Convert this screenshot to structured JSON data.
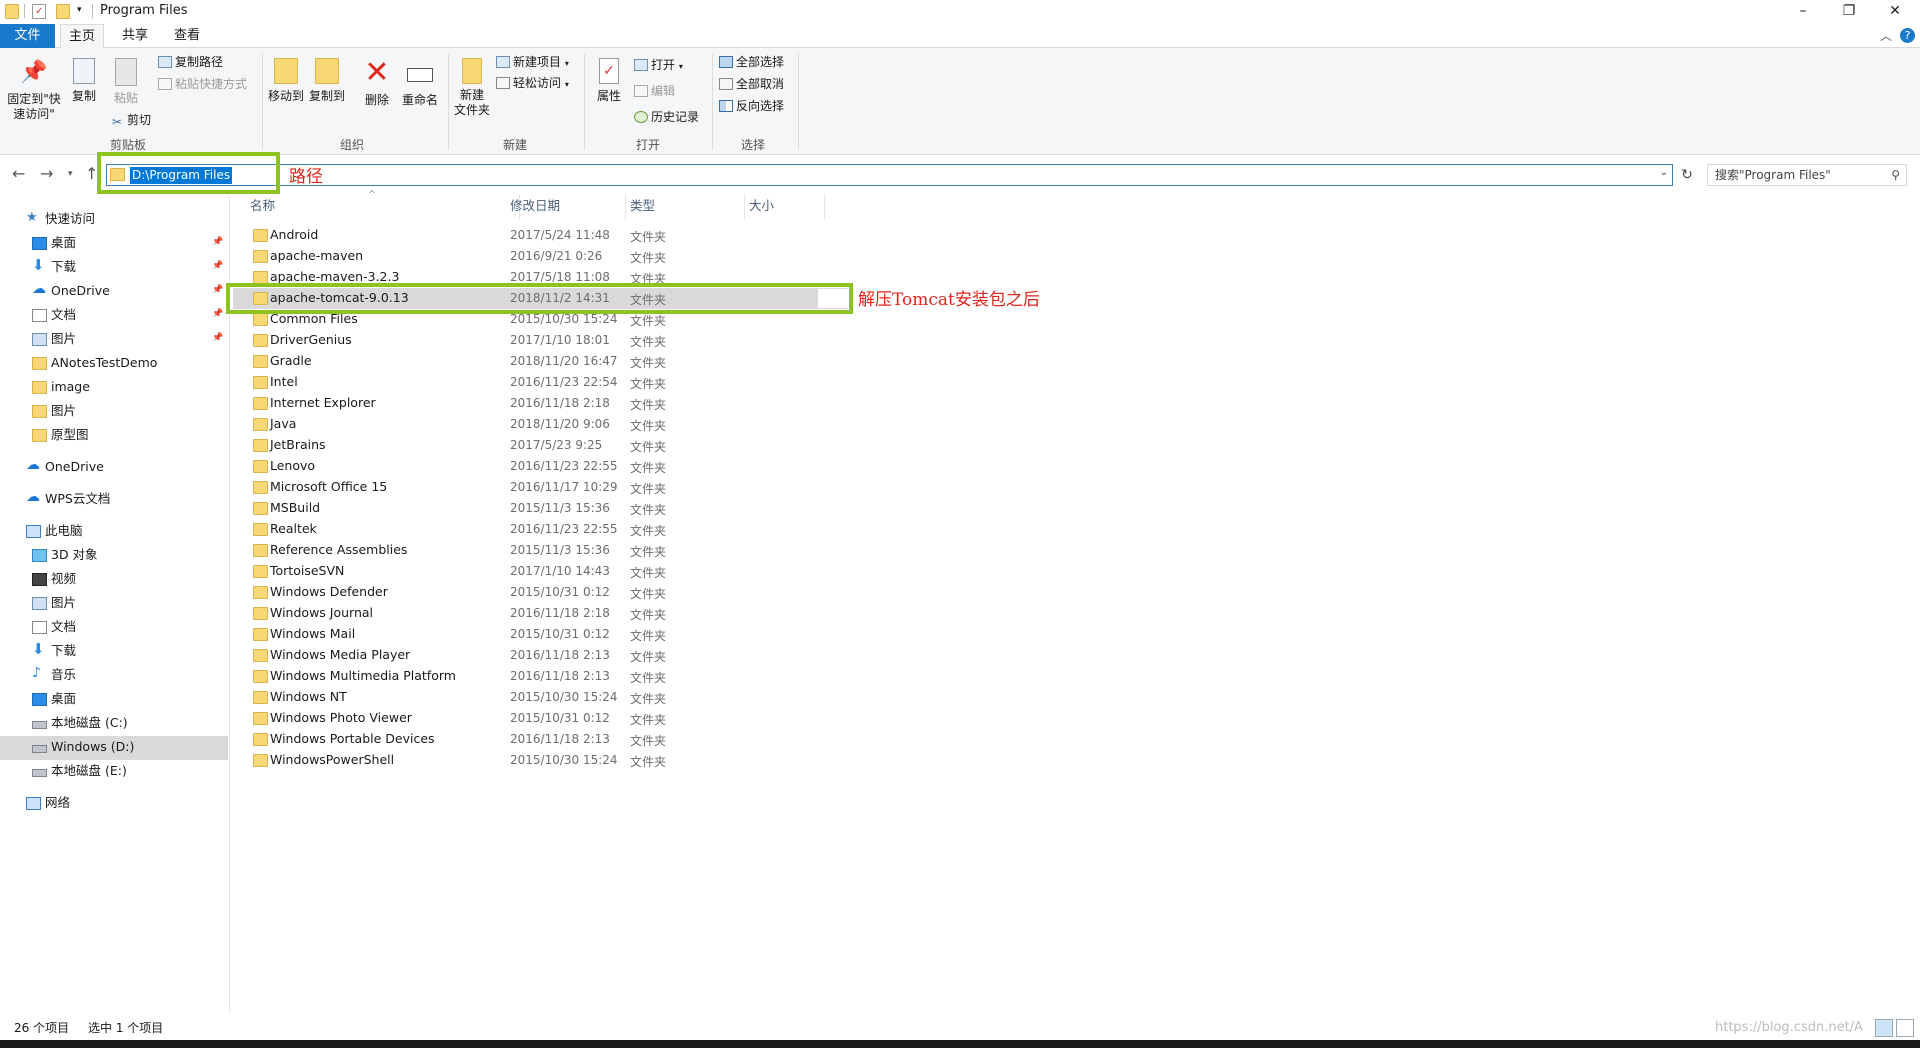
{
  "window": {
    "title": "Program Files",
    "minimize": "–",
    "restore": "❐",
    "close": "✕"
  },
  "tabs": [
    {
      "label": "文件",
      "active_file": true
    },
    {
      "label": "主页",
      "selected": true
    },
    {
      "label": "共享"
    },
    {
      "label": "查看"
    }
  ],
  "ribbon": {
    "pin_quick": "固定到\"快速访问\"",
    "copy": "复制",
    "paste": "粘贴",
    "copy_path": "复制路径",
    "paste_shortcut": "粘贴快捷方式",
    "cut": "剪切",
    "group_clipboard": "剪贴板",
    "move_to": "移动到",
    "copy_to": "复制到",
    "delete": "删除",
    "rename": "重命名",
    "group_organize": "组织",
    "new_folder": "新建\n文件夹",
    "new_item": "新建项目",
    "easy_access": "轻松访问",
    "group_new": "新建",
    "properties": "属性",
    "open": "打开",
    "edit": "编辑",
    "history": "历史记录",
    "group_open": "打开",
    "select_all": "全部选择",
    "select_none": "全部取消",
    "invert_select": "反向选择",
    "group_select": "选择"
  },
  "address": {
    "path": "D:\\Program Files",
    "search_placeholder": "搜索\"Program Files\"",
    "annotation": "路径"
  },
  "nav": {
    "quick_access": "快速访问",
    "items": [
      {
        "label": "快速访问",
        "icon": "star-icon"
      },
      {
        "label": "桌面",
        "icon": "desktop-icon",
        "pinned": true
      },
      {
        "label": "下载",
        "icon": "download-icon",
        "pinned": true
      },
      {
        "label": "OneDrive",
        "icon": "cloud-icon",
        "pinned": true
      },
      {
        "label": "文档",
        "icon": "document-icon",
        "pinned": true
      },
      {
        "label": "图片",
        "icon": "picture-icon",
        "pinned": true
      },
      {
        "label": "ANotesTestDemo",
        "icon": "folder-icon"
      },
      {
        "label": "image",
        "icon": "folder-icon"
      },
      {
        "label": "图片",
        "icon": "folder-icon"
      },
      {
        "label": "原型图",
        "icon": "folder-icon"
      },
      {
        "label": "OneDrive",
        "icon": "cloud-icon"
      },
      {
        "label": "WPS云文档",
        "icon": "cloud-icon"
      },
      {
        "label": "此电脑",
        "icon": "computer-icon"
      },
      {
        "label": "3D 对象",
        "icon": "3d-objects-icon"
      },
      {
        "label": "视频",
        "icon": "video-icon"
      },
      {
        "label": "图片",
        "icon": "picture-icon"
      },
      {
        "label": "文档",
        "icon": "document-icon"
      },
      {
        "label": "下载",
        "icon": "download-icon"
      },
      {
        "label": "音乐",
        "icon": "music-icon"
      },
      {
        "label": "桌面",
        "icon": "desktop-icon"
      },
      {
        "label": "本地磁盘 (C:)",
        "icon": "drive-icon"
      },
      {
        "label": "Windows (D:)",
        "icon": "drive-icon",
        "selected": true
      },
      {
        "label": "本地磁盘 (E:)",
        "icon": "drive-icon"
      },
      {
        "label": "网络",
        "icon": "network-icon"
      }
    ]
  },
  "columns": {
    "name": "名称",
    "modified": "修改日期",
    "type": "类型",
    "size": "大小"
  },
  "files": [
    {
      "name": "Android",
      "modified": "2017/5/24 11:48",
      "type": "文件夹"
    },
    {
      "name": "apache-maven",
      "modified": "2016/9/21 0:26",
      "type": "文件夹"
    },
    {
      "name": "apache-maven-3.2.3",
      "modified": "2017/5/18 11:08",
      "type": "文件夹"
    },
    {
      "name": "apache-tomcat-9.0.13",
      "modified": "2018/11/2 14:31",
      "type": "文件夹",
      "selected": true
    },
    {
      "name": "Common Files",
      "modified": "2015/10/30 15:24",
      "type": "文件夹"
    },
    {
      "name": "DriverGenius",
      "modified": "2017/1/10 18:01",
      "type": "文件夹"
    },
    {
      "name": "Gradle",
      "modified": "2018/11/20 16:47",
      "type": "文件夹"
    },
    {
      "name": "Intel",
      "modified": "2016/11/23 22:54",
      "type": "文件夹"
    },
    {
      "name": "Internet Explorer",
      "modified": "2016/11/18 2:18",
      "type": "文件夹"
    },
    {
      "name": "Java",
      "modified": "2018/11/20 9:06",
      "type": "文件夹"
    },
    {
      "name": "JetBrains",
      "modified": "2017/5/23 9:25",
      "type": "文件夹"
    },
    {
      "name": "Lenovo",
      "modified": "2016/11/23 22:55",
      "type": "文件夹"
    },
    {
      "name": "Microsoft Office 15",
      "modified": "2016/11/17 10:29",
      "type": "文件夹"
    },
    {
      "name": "MSBuild",
      "modified": "2015/11/3 15:36",
      "type": "文件夹"
    },
    {
      "name": "Realtek",
      "modified": "2016/11/23 22:55",
      "type": "文件夹"
    },
    {
      "name": "Reference Assemblies",
      "modified": "2015/11/3 15:36",
      "type": "文件夹"
    },
    {
      "name": "TortoiseSVN",
      "modified": "2017/1/10 14:43",
      "type": "文件夹"
    },
    {
      "name": "Windows Defender",
      "modified": "2015/10/31 0:12",
      "type": "文件夹"
    },
    {
      "name": "Windows Journal",
      "modified": "2016/11/18 2:18",
      "type": "文件夹"
    },
    {
      "name": "Windows Mail",
      "modified": "2015/10/31 0:12",
      "type": "文件夹"
    },
    {
      "name": "Windows Media Player",
      "modified": "2016/11/18 2:13",
      "type": "文件夹"
    },
    {
      "name": "Windows Multimedia Platform",
      "modified": "2016/11/18 2:13",
      "type": "文件夹"
    },
    {
      "name": "Windows NT",
      "modified": "2015/10/30 15:24",
      "type": "文件夹"
    },
    {
      "name": "Windows Photo Viewer",
      "modified": "2015/10/31 0:12",
      "type": "文件夹"
    },
    {
      "name": "Windows Portable Devices",
      "modified": "2016/11/18 2:13",
      "type": "文件夹"
    },
    {
      "name": "WindowsPowerShell",
      "modified": "2015/10/30 15:24",
      "type": "文件夹"
    }
  ],
  "annotation_tomcat": "解压Tomcat安装包之后",
  "status": {
    "count": "26 个项目",
    "selected": "选中 1 个项目"
  },
  "watermark": "https://blog.csdn.net/A",
  "colors": {
    "accent": "#0078d7",
    "highlight_box": "#8dc21f",
    "annotation_text": "#e0261d",
    "folder": "#f8d775"
  }
}
